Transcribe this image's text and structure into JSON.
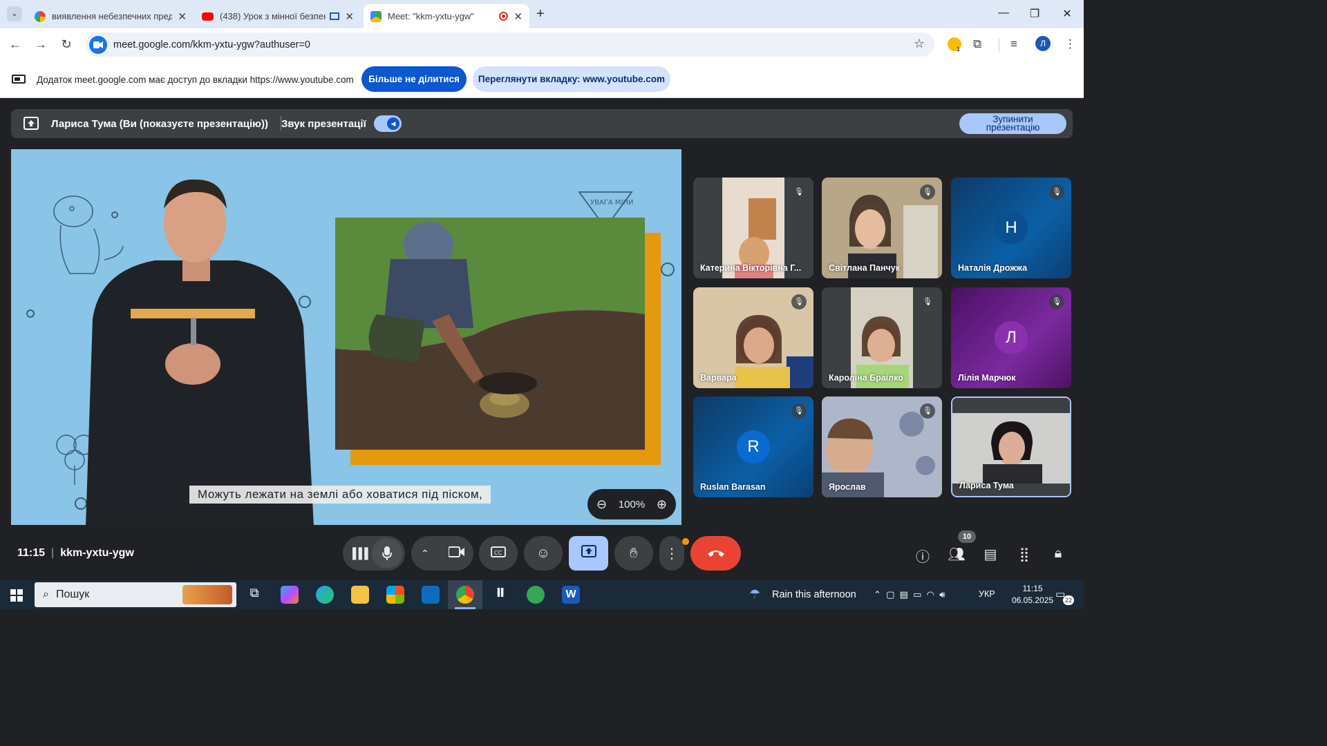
{
  "tabs": [
    {
      "title": "виявлення небезпечних пред…",
      "favicon": "google-icon",
      "active": false
    },
    {
      "title": "(438) Урок з мінної безпек…",
      "favicon": "youtube-icon",
      "active": false
    },
    {
      "title": "Meet: \"kkm-yxtu-ygw\"",
      "favicon": "meet-icon",
      "active": true
    }
  ],
  "address_bar": {
    "url": "meet.google.com/kkm-yxtu-ygw?authuser=0"
  },
  "profile_initial": "Л",
  "extension_badge": "1",
  "share_bar": {
    "message": "Додаток meet.google.com має доступ до вкладки https://www.youtube.com",
    "stop_sharing_label": "Більше не ділитися",
    "view_tab_label": "Переглянути вкладку: www.youtube.com"
  },
  "presenting_bar": {
    "presenter_text": "Лариса Тума (Ви (показуєте презентацію))",
    "audio_label": "Звук презентації",
    "stop_label_line1": "Зупинити",
    "stop_label_line2": "презентацію"
  },
  "stage": {
    "caption": "Можуть лежати на землі або ховатися під піском,",
    "zoom_value": "100%",
    "sign_text": "УВАГА МІНИ"
  },
  "participants": [
    {
      "name": "Катерина Вікторівна Г...",
      "muted": true,
      "type": "video"
    },
    {
      "name": "Світлана Панчук",
      "muted": true,
      "type": "video"
    },
    {
      "name": "Наталія Дрожжа",
      "muted": true,
      "type": "avatar",
      "initial": "Н"
    },
    {
      "name": "Варвара",
      "muted": true,
      "type": "video"
    },
    {
      "name": "Кароліна Браілко",
      "muted": true,
      "type": "video"
    },
    {
      "name": "Лілія Марчюк",
      "muted": true,
      "type": "avatar",
      "initial": "Л"
    },
    {
      "name": "Ruslan Barasan",
      "muted": true,
      "type": "avatar",
      "initial": "R"
    },
    {
      "name": "Ярослав",
      "muted": true,
      "type": "video"
    },
    {
      "name": "Лариса Тума",
      "muted": false,
      "type": "video"
    }
  ],
  "meeting": {
    "time": "11:15",
    "code": "kkm-yxtu-ygw",
    "participant_count": "10"
  },
  "taskbar": {
    "search_placeholder": "Пошук",
    "weather": "Rain this afternoon",
    "language": "УКР",
    "time": "11:15",
    "date": "06.05.2025",
    "notifications": "22"
  },
  "colors": {
    "accent": "#0b57d0",
    "end_call": "#ea4335",
    "present_active": "#a8c7fa"
  }
}
